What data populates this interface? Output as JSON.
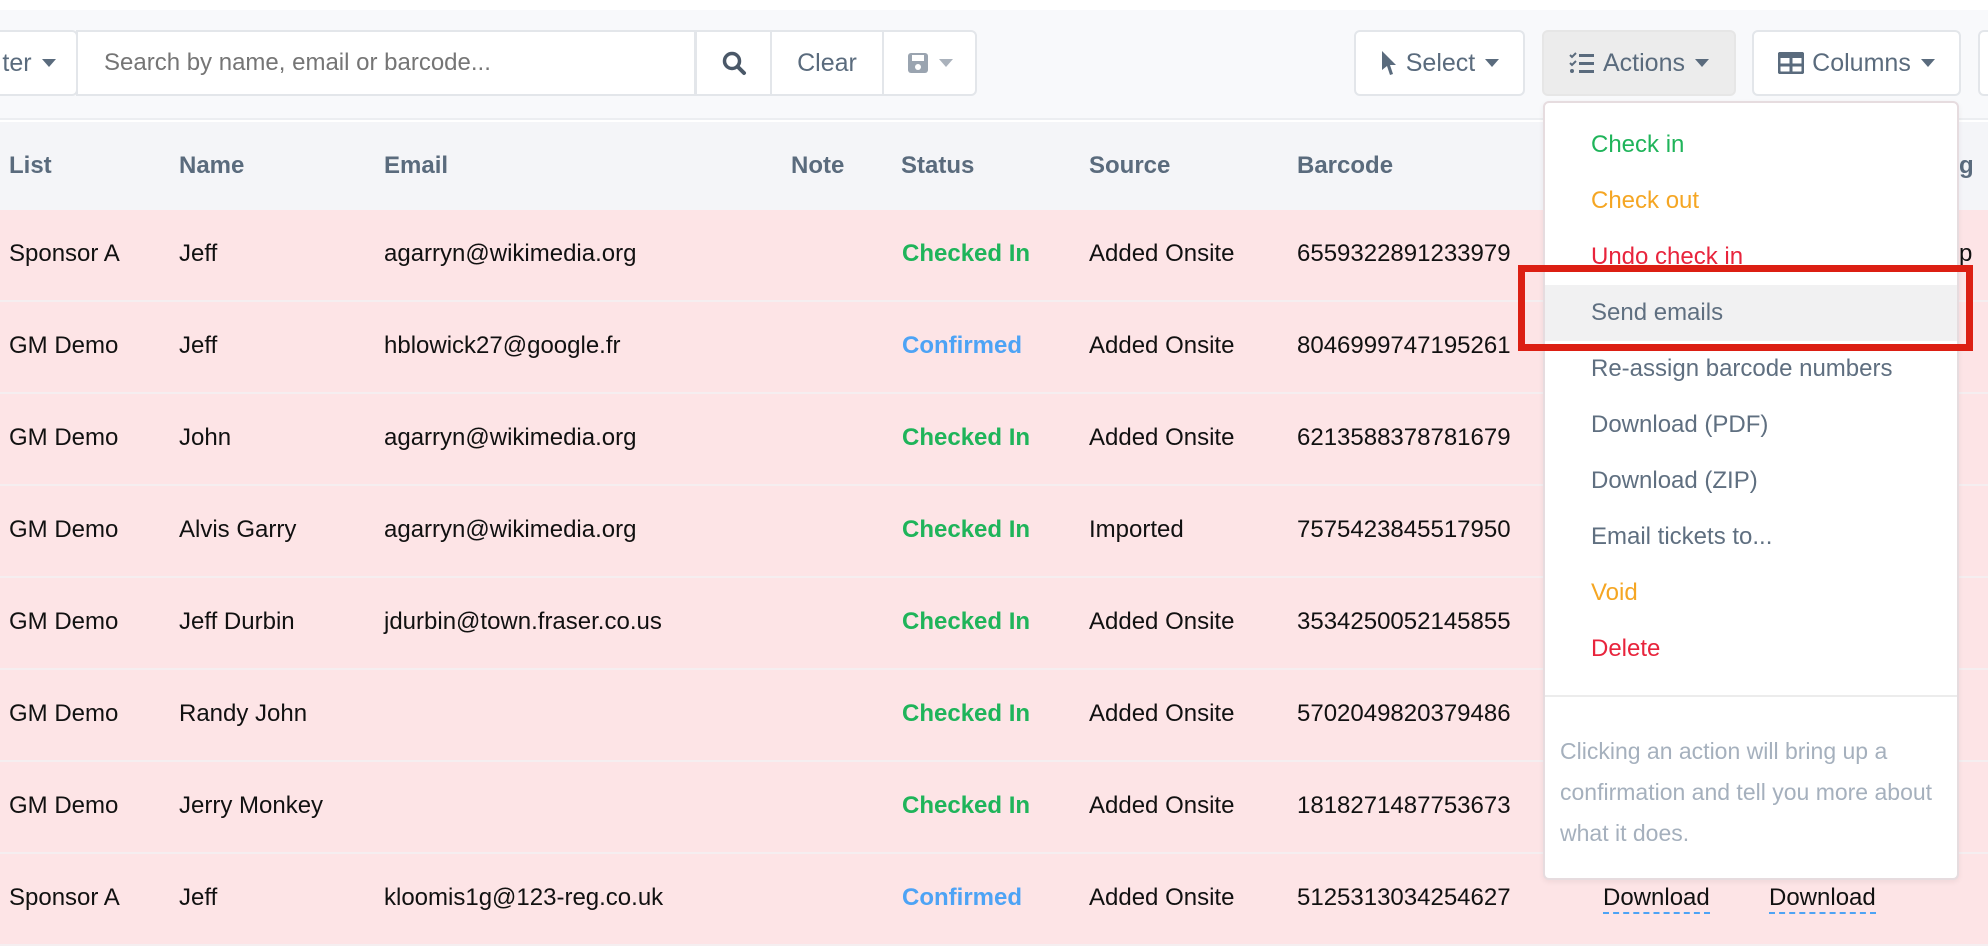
{
  "toolbar": {
    "filter_label": "ter",
    "search_placeholder": "Search by name, email or barcode...",
    "clear_label": "Clear",
    "select_label": "Select",
    "actions_label": "Actions",
    "columns_label": "Columns"
  },
  "table": {
    "headers": [
      "List",
      "Name",
      "Email",
      "Note",
      "Status",
      "Source",
      "Barcode",
      "g"
    ],
    "rows": [
      {
        "list": "Sponsor A",
        "name": "Jeff",
        "email": "agarryn@wikimedia.org",
        "status": "Checked In",
        "source": "Added Onsite",
        "barcode": "6559322891233979",
        "last": "p"
      },
      {
        "list": "GM Demo",
        "name": "Jeff",
        "email": "hblowick27@google.fr",
        "status": "Confirmed",
        "source": "Added Onsite",
        "barcode": "8046999747195261"
      },
      {
        "list": "GM Demo",
        "name": "John",
        "email": "agarryn@wikimedia.org",
        "status": "Checked In",
        "source": "Added Onsite",
        "barcode": "6213588378781679"
      },
      {
        "list": "GM Demo",
        "name": "Alvis Garry",
        "email": "agarryn@wikimedia.org",
        "status": "Checked In",
        "source": "Imported",
        "barcode": "7575423845517950"
      },
      {
        "list": "GM Demo",
        "name": "Jeff Durbin",
        "email": "jdurbin@town.fraser.co.us",
        "status": "Checked In",
        "source": "Added Onsite",
        "barcode": "3534250052145855"
      },
      {
        "list": "GM Demo",
        "name": "Randy John",
        "email": "",
        "status": "Checked In",
        "source": "Added Onsite",
        "barcode": "5702049820379486"
      },
      {
        "list": "GM Demo",
        "name": "Jerry Monkey",
        "email": "",
        "status": "Checked In",
        "source": "Added Onsite",
        "barcode": "1818271487753673"
      },
      {
        "list": "Sponsor A",
        "name": "Jeff",
        "email": "kloomis1g@123-reg.co.uk",
        "status": "Confirmed",
        "source": "Added Onsite",
        "barcode": "5125313034254627",
        "dl1": "Download",
        "dl2": "Download"
      }
    ]
  },
  "actions_menu": {
    "items": [
      {
        "label": "Check in",
        "color": "#1fb45a"
      },
      {
        "label": "Check out",
        "color": "#f5a623"
      },
      {
        "label": "Undo check in",
        "color": "#e8243c"
      },
      {
        "label": "Send emails",
        "color": "#5f6f80"
      },
      {
        "label": "Re-assign barcode numbers",
        "color": "#5f6f80"
      },
      {
        "label": "Download (PDF)",
        "color": "#5f6f80"
      },
      {
        "label": "Download (ZIP)",
        "color": "#5f6f80"
      },
      {
        "label": "Email tickets to...",
        "color": "#5f6f80"
      },
      {
        "label": "Void",
        "color": "#f5a623"
      },
      {
        "label": "Delete",
        "color": "#e8243c"
      }
    ],
    "highlighted": "Send emails",
    "help": "Clicking an action will bring up a confirmation and tell you more about what it does."
  },
  "status_colors": {
    "Checked In": "#1fb45a",
    "Confirmed": "#4da3f5"
  }
}
